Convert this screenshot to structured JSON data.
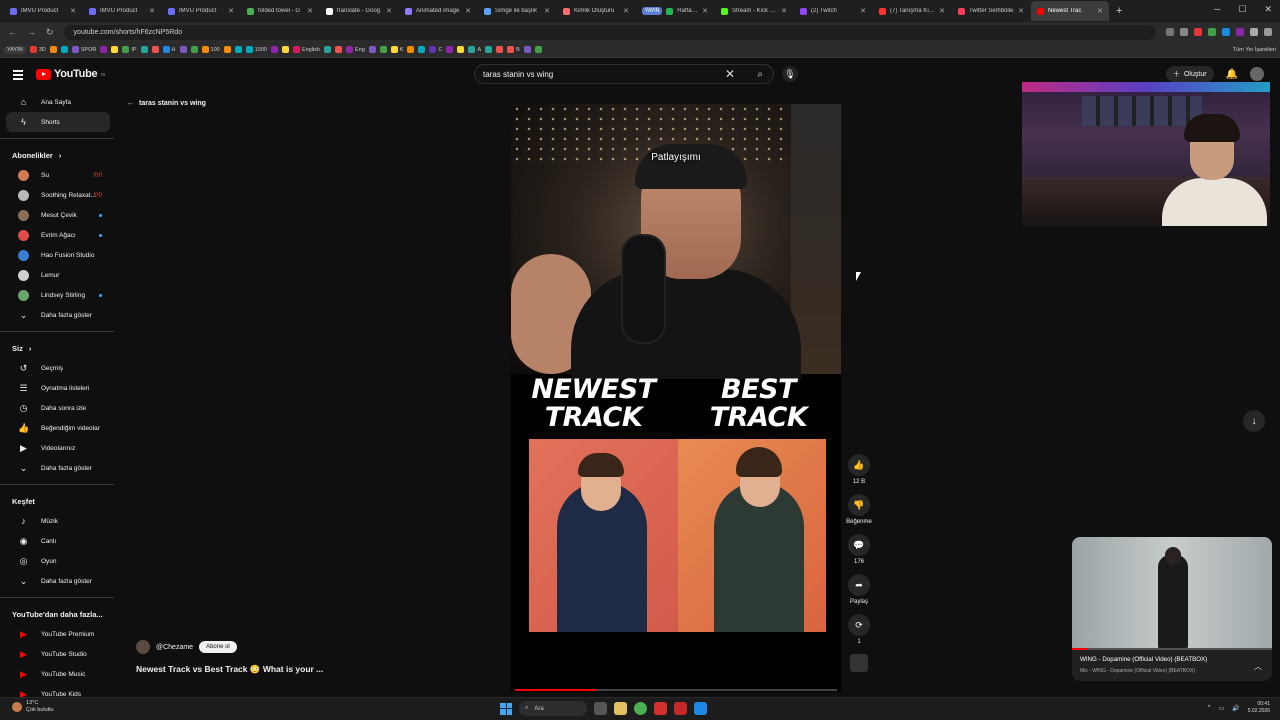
{
  "browser": {
    "tabs": [
      {
        "title": "IMVU Product",
        "color": "#6b6bff"
      },
      {
        "title": "IMVU Product",
        "color": "#6b6bff"
      },
      {
        "title": "IMVU Product",
        "color": "#6b6bff"
      },
      {
        "title": "folded towel - G",
        "color": "#4caf50"
      },
      {
        "title": "translate - Goog",
        "color": "#ffffff"
      },
      {
        "title": "Animated image",
        "color": "#8e7bff"
      },
      {
        "title": "Simge ile başlık",
        "color": "#5aa0ff"
      },
      {
        "title": "Kimlik Oluşturu",
        "color": "#ff6e6e"
      },
      {
        "title": "Haftalık Keşif | S",
        "color": "#1db954",
        "badge": "YAYIN"
      },
      {
        "title": "Stream - Kick Da",
        "color": "#53fc18"
      },
      {
        "title": "(2) Twitch",
        "color": "#9146ff"
      },
      {
        "title": "(7) Tanışma Kıya",
        "color": "#ff3333"
      },
      {
        "title": "Twitter Sembolle",
        "color": "#ff3b5c"
      },
      {
        "title": "Newest Trac",
        "color": "#ff0000",
        "active": true
      }
    ],
    "new_tab": "+",
    "url": "youtube.com/shorts/hF6zcNP5Rdo",
    "bookmarks": {
      "badge": "YAYIN",
      "items": [
        "3D",
        "SPOR",
        "IP",
        "H",
        "100",
        "1000",
        "English",
        "Eng",
        "K",
        "C",
        "A",
        "B"
      ],
      "all_bookmarks": "Tüm Yer İşaretleri"
    }
  },
  "youtube": {
    "logo_text": "YouTube",
    "logo_region": "TR",
    "search_query": "taras stanin vs wing",
    "create_label": "Oluştur",
    "sidebar": {
      "main": [
        {
          "label": "Ana Sayfa",
          "icon": "home-icon"
        },
        {
          "label": "Shorts",
          "icon": "shorts-icon",
          "active": true
        }
      ],
      "subs_header": "Abonelikler",
      "subs": [
        {
          "label": "Su",
          "color": "#d37a52",
          "status": "live"
        },
        {
          "label": "Soothing Relaxat...",
          "color": "#b9b9b9",
          "status": "live"
        },
        {
          "label": "Mesut Çevik",
          "color": "#8a6f5b",
          "status": "dot"
        },
        {
          "label": "Evrim Ağacı",
          "color": "#e24b4b",
          "status": "dot"
        },
        {
          "label": "Hao Fusion Studio",
          "color": "#3a7bd5",
          "status": ""
        },
        {
          "label": "Lemur",
          "color": "#d0d0d0",
          "status": ""
        },
        {
          "label": "Lindsey Stirling",
          "color": "#6aa56a",
          "status": "dot"
        }
      ],
      "subs_more": "Daha fazla göster",
      "you_header": "Siz",
      "you": [
        {
          "label": "Geçmiş",
          "icon": "history-icon"
        },
        {
          "label": "Oynatma listeleri",
          "icon": "playlist-icon"
        },
        {
          "label": "Daha sonra izle",
          "icon": "clock-icon"
        },
        {
          "label": "Beğendiğim videolar",
          "icon": "thumbs-up-icon"
        },
        {
          "label": "Videolarınız",
          "icon": "video-icon"
        },
        {
          "label": "Daha fazla göster",
          "icon": "chevron-down-icon"
        }
      ],
      "explore_header": "Keşfet",
      "explore": [
        {
          "label": "Müzik",
          "icon": "music-icon"
        },
        {
          "label": "Canlı",
          "icon": "live-icon"
        },
        {
          "label": "Oyun",
          "icon": "gamepad-icon"
        },
        {
          "label": "Daha fazla göster",
          "icon": "chevron-down-icon"
        }
      ],
      "more_header": "YouTube'dan daha fazla...",
      "more": [
        {
          "label": "YouTube Premium"
        },
        {
          "label": "YouTube Studio"
        },
        {
          "label": "YouTube Music"
        },
        {
          "label": "YouTube Kids"
        }
      ]
    },
    "back_label": "taras stanin vs wing",
    "short": {
      "caption": "Patlayışımı",
      "label_left": "NEWEST TRACK",
      "label_right": "BEST TRACK",
      "channel": "@Chezame",
      "subscribe": "Abone ol",
      "title": "Newest Track vs Best Track 😳 What is your ...",
      "progress": 0.25
    },
    "actions": {
      "likes": "12 B",
      "dislike": "Beğenme",
      "comments": "176",
      "share": "Paylaş",
      "remix": "1"
    },
    "miniplayer": {
      "title": "WING - Dopamine (Official Video) (BEATBOX)",
      "subtitle": "Mix - WING - Dopamine (Official Video) (BEATBOX)",
      "progress": 0.08
    }
  },
  "taskbar": {
    "temp": "13°C",
    "weather": "Çok bulutlu",
    "search": "Ara",
    "time": "00:41",
    "date": "5.02.2026"
  }
}
